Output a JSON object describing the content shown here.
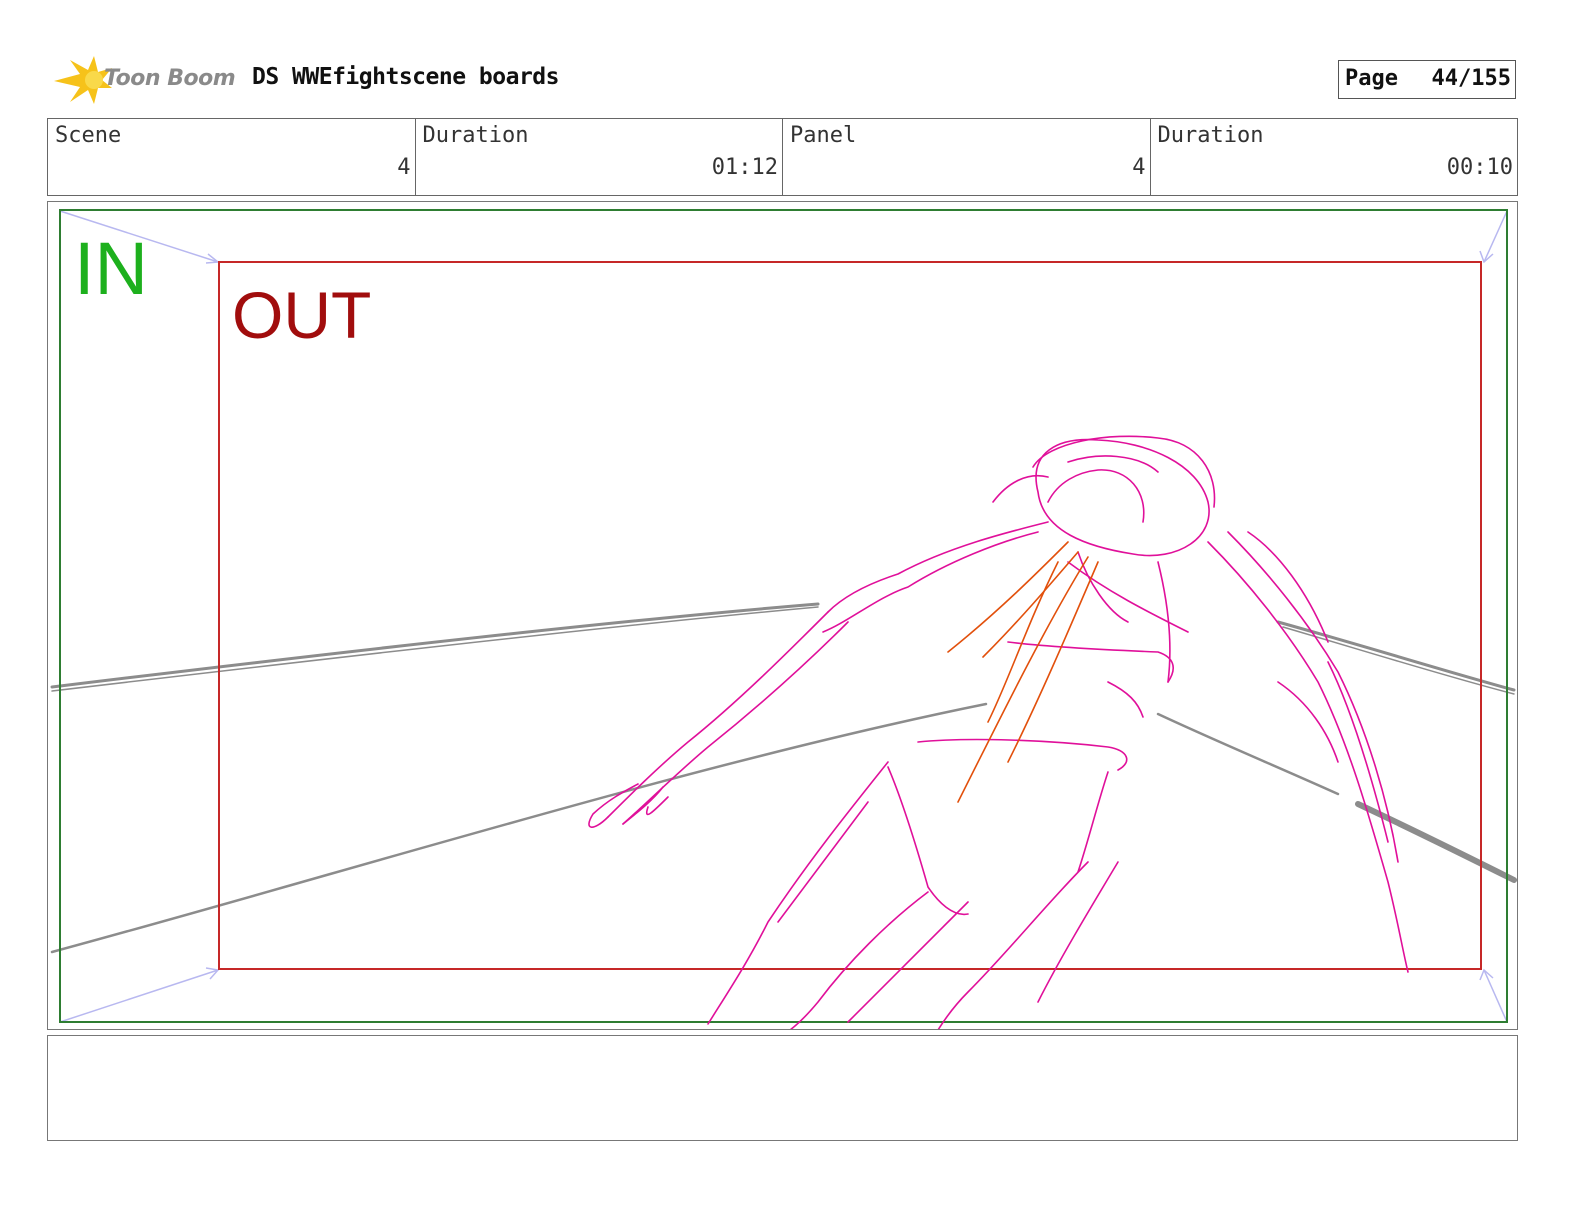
{
  "header": {
    "logo_text": "Toon Boom",
    "title": "DS WWEfightscene boards",
    "page_label": "Page",
    "page_number": "44/155"
  },
  "info": {
    "scene_label": "Scene",
    "scene_value": "4",
    "scene_duration_label": "Duration",
    "scene_duration_value": "01:12",
    "panel_label": "Panel",
    "panel_value": "4",
    "panel_duration_label": "Duration",
    "panel_duration_value": "00:10"
  },
  "panel": {
    "in_label": "IN",
    "out_label": "OUT",
    "colors": {
      "in_frame": "#2e7d32",
      "out_frame": "#c62828",
      "in_text": "#1db01d",
      "out_text": "#a10d0d",
      "figure": "#e0109a",
      "blood": "#e2500c",
      "ropes": "#8c8c8c",
      "camera_arrows": "#b8b8f0"
    }
  },
  "notes": {
    "text": ""
  }
}
